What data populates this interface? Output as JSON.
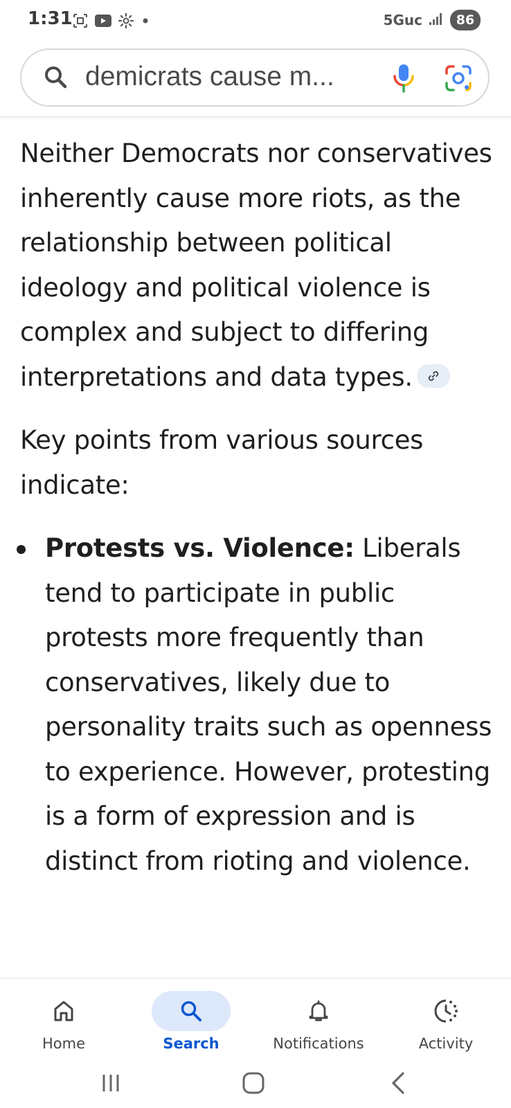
{
  "status_bar": {
    "time": "1:31",
    "network": "5Guc",
    "battery": "86",
    "icons": [
      "screenshot-icon",
      "youtube-icon",
      "settings-icon",
      "notification-dot-icon",
      "signal-icon"
    ]
  },
  "search": {
    "query": "demicrats cause m...",
    "icons": [
      "search-icon",
      "mic-icon",
      "lens-icon"
    ]
  },
  "content": {
    "paragraph1": "Neither Democrats nor conservatives inherently cause more riots, as the relationship between political ideology and political violence is complex and subject to differing interpretations and data types.",
    "paragraph2": "Key points from various sources indicate:",
    "bullets": [
      {
        "heading": "Protests vs. Violence:",
        "text": " Liberals tend to participate in public protests more frequently than conservatives, likely due to personality traits such as openness to experience. However, protesting is a form of expression and is distinct from rioting and violence."
      }
    ]
  },
  "bottom_nav": {
    "items": [
      {
        "label": "Home",
        "icon": "home-icon",
        "active": false
      },
      {
        "label": "Search",
        "icon": "search-icon",
        "active": true
      },
      {
        "label": "Notifications",
        "icon": "bell-icon",
        "active": false
      },
      {
        "label": "Activity",
        "icon": "activity-icon",
        "active": false
      }
    ]
  },
  "system_nav": [
    "recents-icon",
    "home-button-icon",
    "back-icon"
  ],
  "colors": {
    "accent": "#0b57d0",
    "active_pill": "#dde8fb",
    "text": "#1f1f1f",
    "link_chip": "#e8eef8"
  }
}
